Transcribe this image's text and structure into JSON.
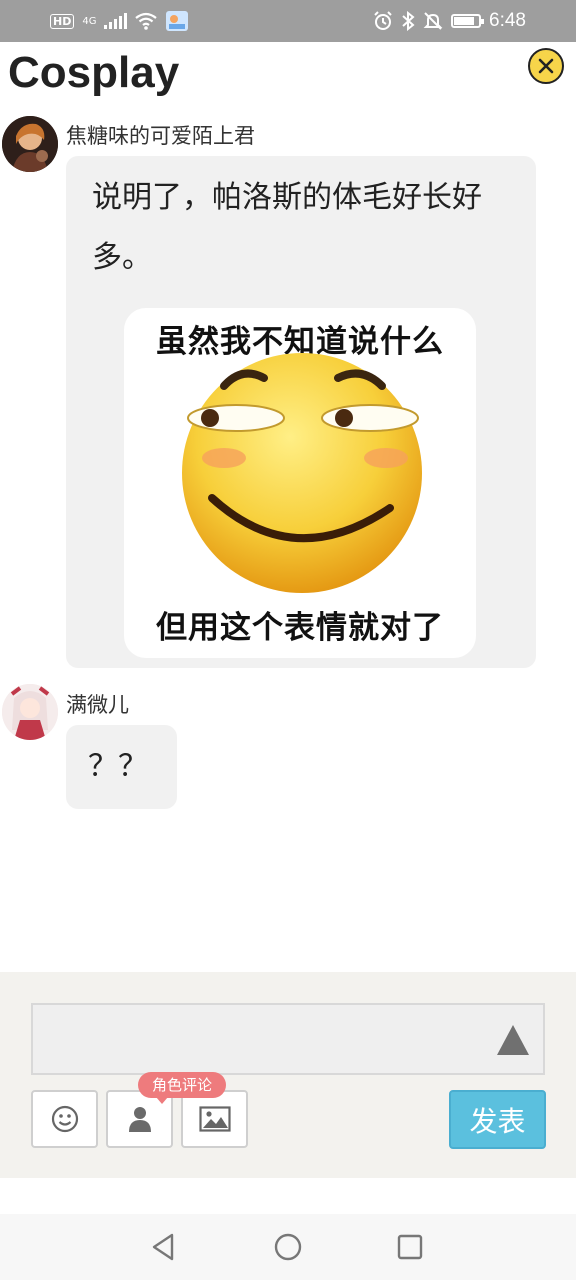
{
  "status_bar": {
    "network_badge": "HD",
    "network_type": "4G",
    "time": "6:48",
    "icons": [
      "signal-icon",
      "wifi-icon",
      "app-notification-icon",
      "alarm-icon",
      "bluetooth-icon",
      "mute-icon",
      "battery-icon"
    ]
  },
  "header": {
    "title": "Cosplay",
    "close_icon": "close-icon"
  },
  "messages": [
    {
      "author": "焦糖味的可爱陌上君",
      "text_line1": "说明了，帕洛斯的体毛好长好",
      "text_line2": "多。",
      "sticker": {
        "top_text": "虽然我不知道说什么",
        "bottom_text": "但用这个表情就对了"
      }
    },
    {
      "author": "满微儿",
      "text": "？？"
    }
  ],
  "composer": {
    "input_value": "",
    "expand_icon": "triangle-up-icon",
    "tools": [
      "emoji-icon",
      "role-icon",
      "image-icon"
    ],
    "role_badge": "角色评论",
    "send_label": "发表"
  },
  "navigation": {
    "buttons": [
      "back-icon",
      "home-icon",
      "recents-icon"
    ]
  },
  "colors": {
    "status_bar": "#9e9e9e",
    "close_button": "#f7d54a",
    "bubble": "#f1f1f1",
    "send_button": "#5bc0de",
    "role_badge": "#ee7b7d",
    "composer_bg": "#f3f2ee"
  }
}
